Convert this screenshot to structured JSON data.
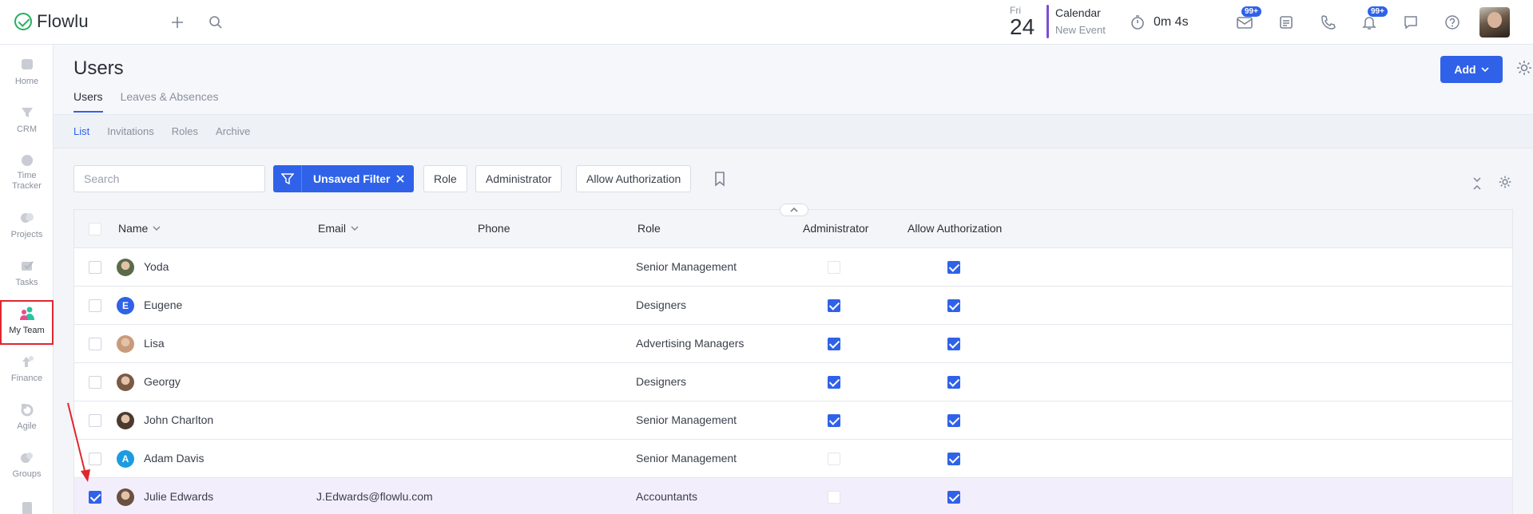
{
  "app": {
    "name": "Flowlu"
  },
  "topbar": {
    "date": {
      "dow": "Fri",
      "day": "24"
    },
    "calendar": {
      "title": "Calendar",
      "sub": "New Event"
    },
    "timer": "0m 4s",
    "mail_badge": "99+",
    "notif_badge": "99+"
  },
  "sidebar": {
    "items": [
      {
        "label": "Home",
        "icon": "heart-icon"
      },
      {
        "label": "CRM",
        "icon": "crm-icon"
      },
      {
        "label": "Time Tracker",
        "icon": "time-tracker-icon"
      },
      {
        "label": "Projects",
        "icon": "projects-icon"
      },
      {
        "label": "Tasks",
        "icon": "tasks-icon"
      },
      {
        "label": "My Team",
        "icon": "team-icon"
      },
      {
        "label": "Finance",
        "icon": "finance-icon"
      },
      {
        "label": "Agile",
        "icon": "agile-icon"
      },
      {
        "label": "Groups",
        "icon": "groups-icon"
      }
    ]
  },
  "page": {
    "title": "Users",
    "tabs": [
      "Users",
      "Leaves & Absences"
    ],
    "add_label": "Add"
  },
  "subtabs": [
    "List",
    "Invitations",
    "Roles",
    "Archive"
  ],
  "filters": {
    "search_placeholder": "Search",
    "unsaved_filter": "Unsaved Filter",
    "chips": [
      "Role",
      "Administrator",
      "Allow Authorization"
    ]
  },
  "table": {
    "columns": [
      "Name",
      "Email",
      "Phone",
      "Role",
      "Administrator",
      "Allow Authorization"
    ],
    "rows": [
      {
        "name": "Yoda",
        "email": "",
        "phone": "",
        "role": "Senior Management",
        "admin": false,
        "auth": true,
        "selected": false,
        "avatar": {
          "type": "photo",
          "color": "#5b6b4a"
        }
      },
      {
        "name": "Eugene",
        "email": "",
        "phone": "",
        "role": "Designers",
        "admin": true,
        "auth": true,
        "selected": false,
        "avatar": {
          "type": "letter",
          "letter": "E",
          "color": "#2f62e8"
        }
      },
      {
        "name": "Lisa",
        "email": "",
        "phone": "",
        "role": "Advertising Managers",
        "admin": true,
        "auth": true,
        "selected": false,
        "avatar": {
          "type": "photo",
          "color": "#c99a7a"
        }
      },
      {
        "name": "Georgy",
        "email": "",
        "phone": "",
        "role": "Designers",
        "admin": true,
        "auth": true,
        "selected": false,
        "avatar": {
          "type": "photo",
          "color": "#7a5a44"
        }
      },
      {
        "name": "John Charlton",
        "email": "",
        "phone": "",
        "role": "Senior Management",
        "admin": true,
        "auth": true,
        "selected": false,
        "avatar": {
          "type": "photo",
          "color": "#4a3a30"
        }
      },
      {
        "name": "Adam Davis",
        "email": "",
        "phone": "",
        "role": "Senior Management",
        "admin": false,
        "auth": true,
        "selected": false,
        "avatar": {
          "type": "letter",
          "letter": "A",
          "color": "#1e9be0"
        }
      },
      {
        "name": "Julie Edwards",
        "email": "J.Edwards@flowlu.com",
        "phone": "",
        "role": "Accountants",
        "admin": false,
        "auth": true,
        "selected": true,
        "avatar": {
          "type": "photo",
          "color": "#6a5040"
        }
      }
    ]
  },
  "colors": {
    "accent": "#2f62e8",
    "highlight": "#e0262e",
    "selected_row": "#f3eefb"
  }
}
